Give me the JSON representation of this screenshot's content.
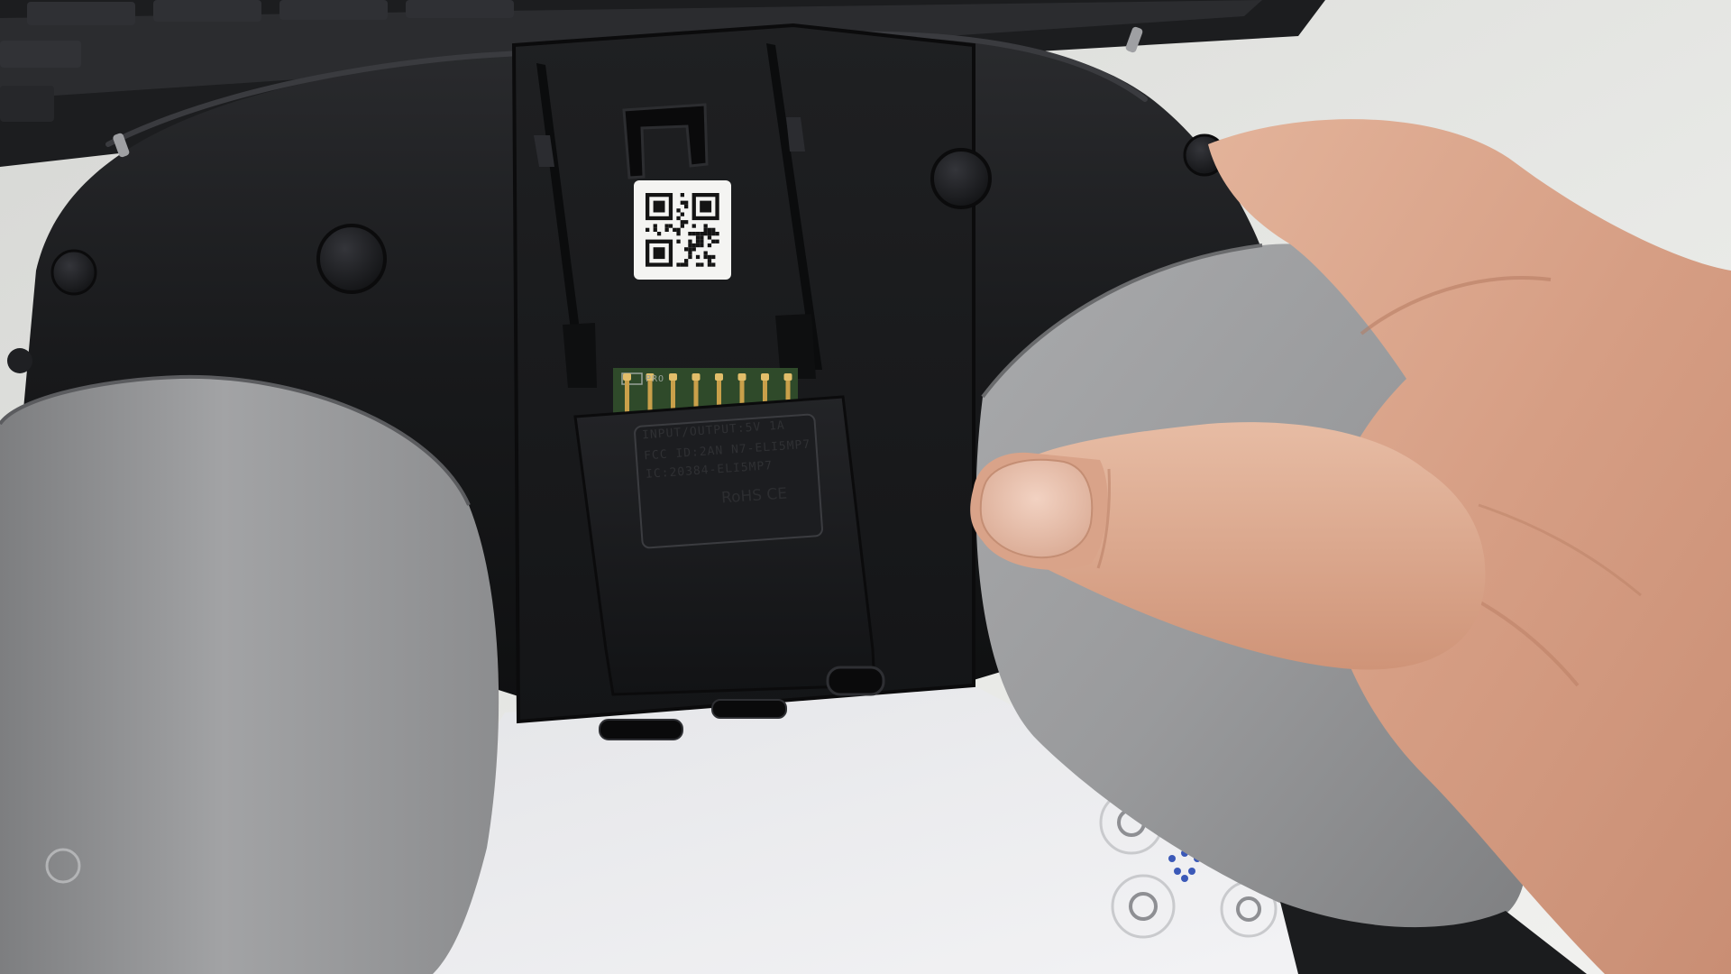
{
  "photo": {
    "subject": "controller-rear-battery-bay",
    "colors": {
      "table": "#e9eae7",
      "shell_black": "#17181a",
      "grip_grey": "#8f9092",
      "contacts_gold": "#c9a04a",
      "pcb_green": "#2f4a2a",
      "skin": "#d9a48a"
    }
  },
  "battery_label": {
    "line1": "INPUT/OUTPUT:5V 1A",
    "line2": "FCC ID:2AN N7-ELI5MP7",
    "line3": "IC:20384-ELI5MP7",
    "marks": "RoHS  CE"
  },
  "pcb_marking": "PRO"
}
